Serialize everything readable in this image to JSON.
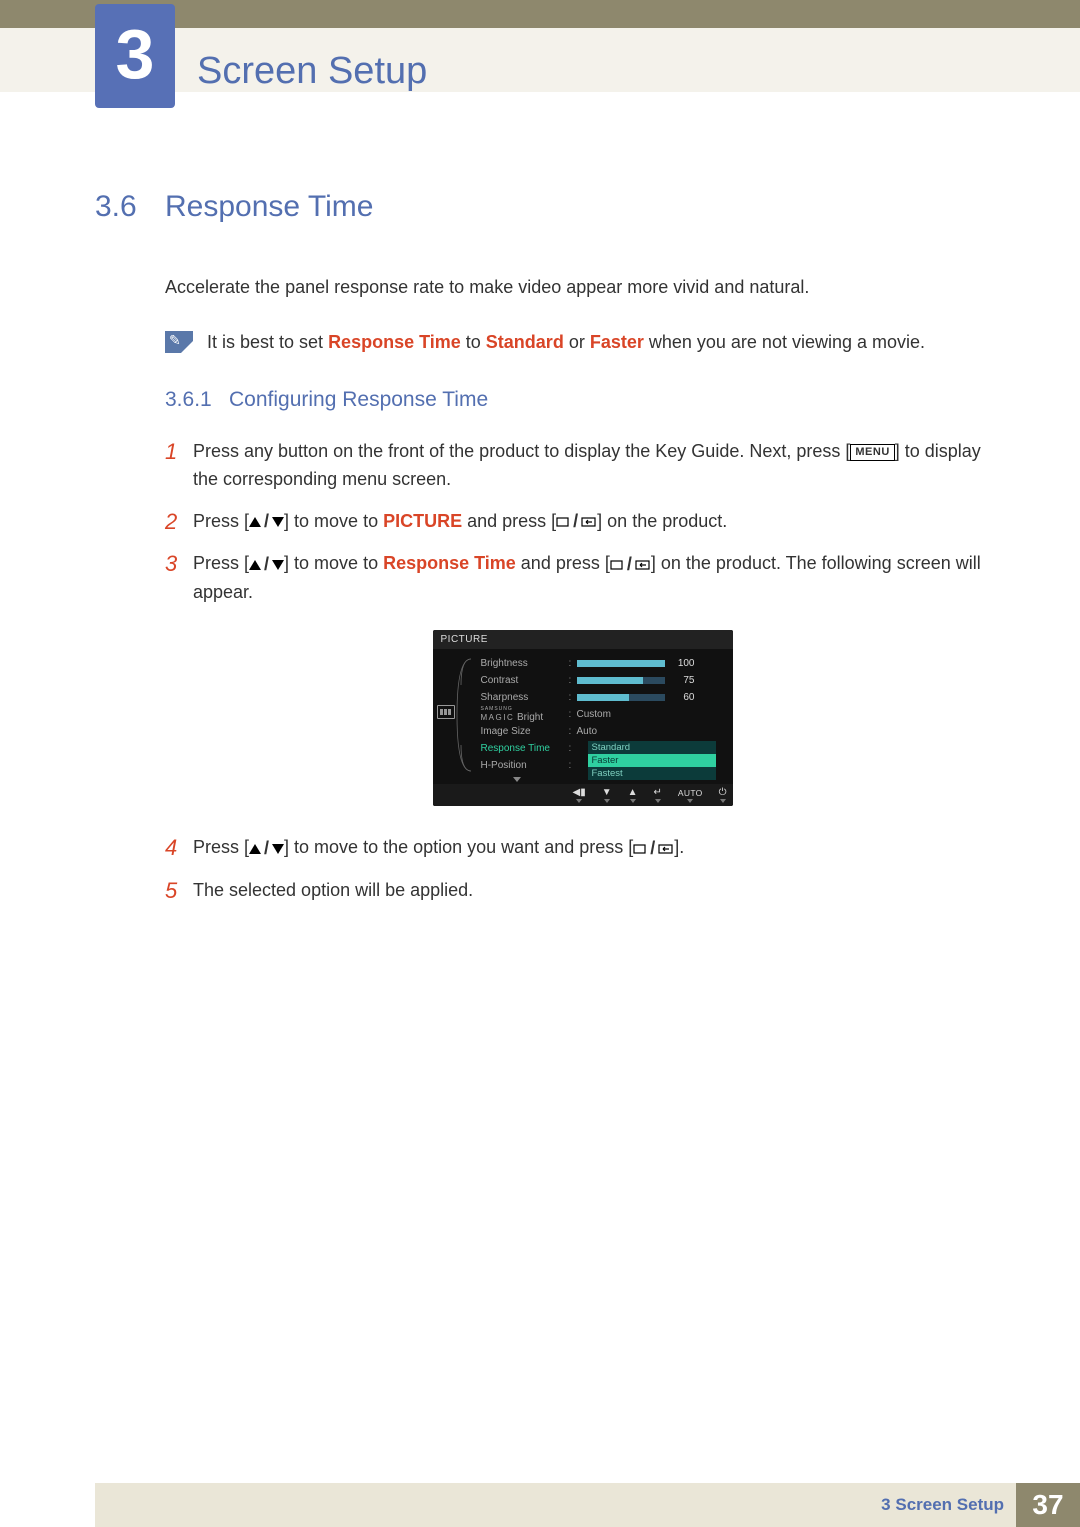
{
  "chapter": {
    "number": "3",
    "title": "Screen Setup"
  },
  "section": {
    "number": "3.6",
    "title": "Response Time"
  },
  "intro": "Accelerate the panel response rate to make video appear more vivid and natural.",
  "note": {
    "pre": "It is best to set ",
    "em1": "Response Time",
    "mid1": " to ",
    "em2": "Standard",
    "mid2": " or ",
    "em3": "Faster",
    "post": " when you are not viewing a movie."
  },
  "subsection": {
    "number": "3.6.1",
    "title": "Configuring Response Time"
  },
  "steps": {
    "s1": {
      "num": "1",
      "pre": "Press any button on the front of the product to display the Key Guide. Next, press [",
      "menu": "MENU",
      "post": "] to display the corresponding menu screen."
    },
    "s2": {
      "num": "2",
      "pre": "Press [",
      "mid1": "] to move to ",
      "em": "PICTURE",
      "mid2": " and press [",
      "post": "] on the product."
    },
    "s3": {
      "num": "3",
      "pre": "Press [",
      "mid1": "] to move to ",
      "em": "Response Time",
      "mid2": " and press [",
      "post": "] on the product. The following screen will appear."
    },
    "s4": {
      "num": "4",
      "pre": "Press [",
      "mid": "] to move to the option you want and press [",
      "post": "]."
    },
    "s5": {
      "num": "5",
      "text": "The selected option will be applied."
    }
  },
  "osd": {
    "header": "PICTURE",
    "items": {
      "brightness": {
        "label": "Brightness",
        "value": 100,
        "max": 100
      },
      "contrast": {
        "label": "Contrast",
        "value": 75,
        "max": 100
      },
      "sharpness": {
        "label": "Sharpness",
        "value": 60,
        "max": 100
      },
      "magic": {
        "top": "SAMSUNG",
        "bot": "MAGIC",
        "suffix": "Bright",
        "value": "Custom"
      },
      "imagesize": {
        "label": "Image Size",
        "value": "Auto"
      },
      "resptime": {
        "label": "Response Time"
      },
      "hpos": {
        "label": "H-Position"
      }
    },
    "dropdown": [
      "Standard",
      "Faster",
      "Fastest"
    ],
    "dropdown_selected": 1,
    "footer": {
      "auto": "AUTO"
    }
  },
  "footer": {
    "chapter_ref": "3 Screen Setup",
    "page": "37"
  },
  "chart_data": {
    "type": "bar",
    "title": "PICTURE OSD sliders",
    "categories": [
      "Brightness",
      "Contrast",
      "Sharpness"
    ],
    "values": [
      100,
      75,
      60
    ],
    "ylim": [
      0,
      100
    ]
  }
}
